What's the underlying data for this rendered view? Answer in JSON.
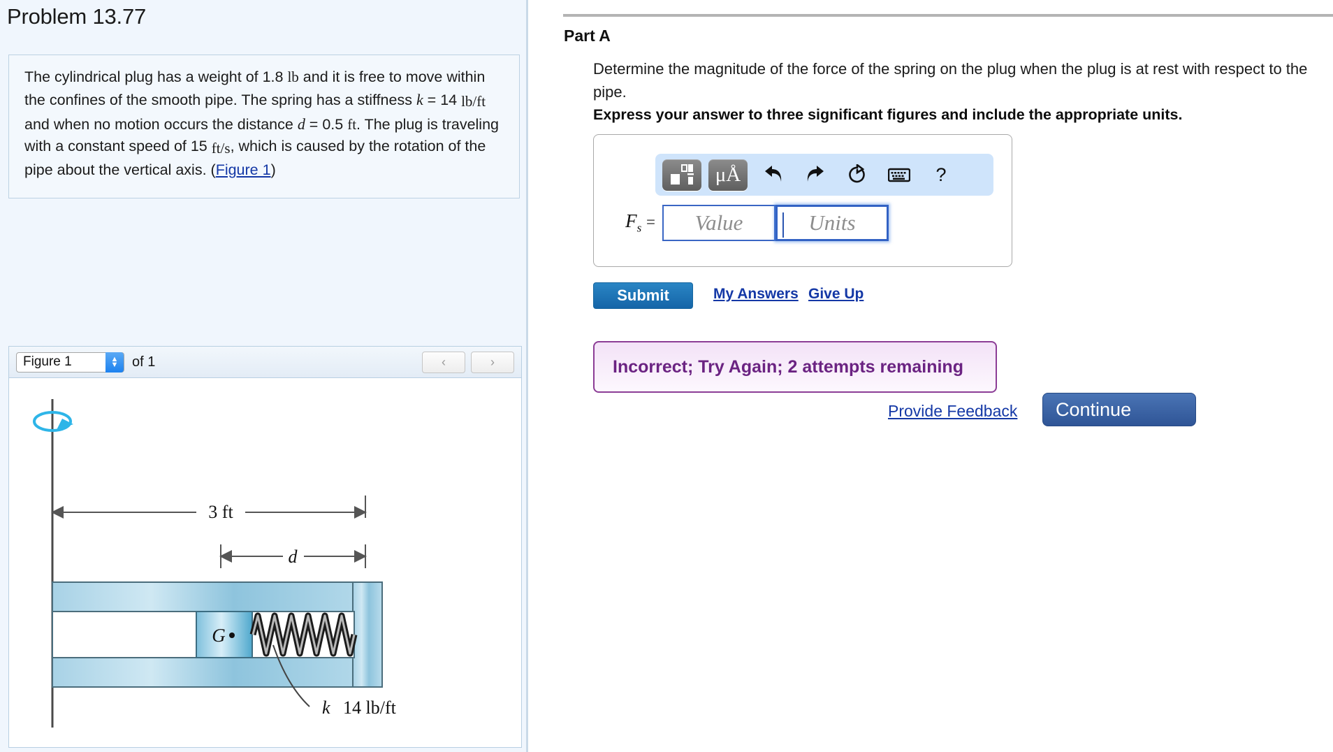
{
  "left": {
    "problem_title": "Problem 13.77",
    "statement": {
      "part1": "The cylindrical plug has a weight of 1.8 ",
      "lb": "lb",
      "part2": " and it is free to move within the confines of the smooth pipe. The spring has a stiffness ",
      "k_sym": "k",
      "eq1": " = 14 ",
      "k_units": "lb/ft",
      "part3": " and when no motion occurs the distance ",
      "d_sym": "d",
      "eq2": " = 0.5 ",
      "d_units": "ft",
      "part4": ". The plug is traveling with a constant speed of 15 ",
      "v_units": "ft/s",
      "part5": ", which is caused by the rotation of the pipe about the vertical axis. (",
      "figure_link": "Figure 1",
      "part6": ")"
    },
    "figure_toolbar": {
      "selected_figure": "Figure 1",
      "of_count": "of 1",
      "prev_label": "‹",
      "next_label": "›"
    },
    "figure_labels": {
      "dim_3ft": "3 ft",
      "dim_d": "d",
      "plug_label": "G",
      "spring_k": "k",
      "spring_value": "14 lb/ft"
    }
  },
  "right": {
    "part_title": "Part A",
    "question": "Determine the magnitude of the force of the spring on the plug when the plug is at rest with respect to the pipe.",
    "instruction": "Express your answer to three significant figures and include the appropriate units.",
    "toolbar": {
      "template_label": "template-icon",
      "units_label": "μÅ",
      "undo_label": "↩",
      "redo_label": "↪",
      "reset_label": "↻",
      "keyboard_label": "keyboard-icon",
      "help_label": "?"
    },
    "answer": {
      "variable": "F",
      "subscript": "s",
      "equals": "=",
      "value_placeholder": "Value",
      "units_placeholder": "Units",
      "value_current": "",
      "units_current": ""
    },
    "submit_label": "Submit",
    "my_answers_label": "My Answers",
    "give_up_label": "Give Up",
    "status_message": "Incorrect; Try Again; 2 attempts remaining",
    "provide_feedback_label": "Provide Feedback",
    "continue_label": "Continue"
  },
  "colors": {
    "accent_blue": "#1565a8",
    "link_blue": "#1438a6",
    "panel_bg": "#f0f6fd",
    "status_purple": "#6b2382",
    "toolbar_blue": "#cfe4fb"
  }
}
